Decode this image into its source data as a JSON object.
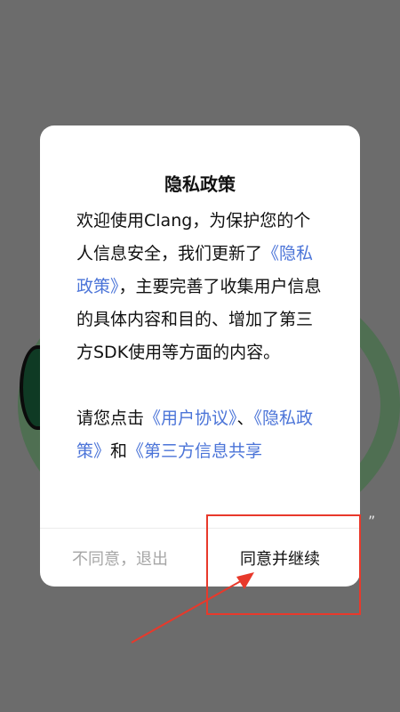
{
  "dialog": {
    "title": "隐私政策",
    "para1": {
      "text_before": "欢迎使用Clang，为保护您的个人信息安全，我们更新了",
      "link_privacy": "《隐私政策》",
      "text_after": "，主要完善了收集用户信息的具体内容和目的、增加了第三方SDK使用等方面的内容。"
    },
    "para2": {
      "text_before": "请您点击",
      "link_user_agreement": "《用户协议》",
      "separator": "、",
      "link_privacy": "《隐私政策》",
      "conjunction": "和",
      "link_third_party": "《第三方信息共享"
    },
    "buttons": {
      "disagree_label": "不同意，退出",
      "agree_label": "同意并继续"
    }
  },
  "background": {
    "quote_mark": "”"
  },
  "colors": {
    "overlay": "#6c6c6c",
    "link": "#4b74d8",
    "disagree_text": "#a6a6a6",
    "annotation": "#e8392b"
  }
}
